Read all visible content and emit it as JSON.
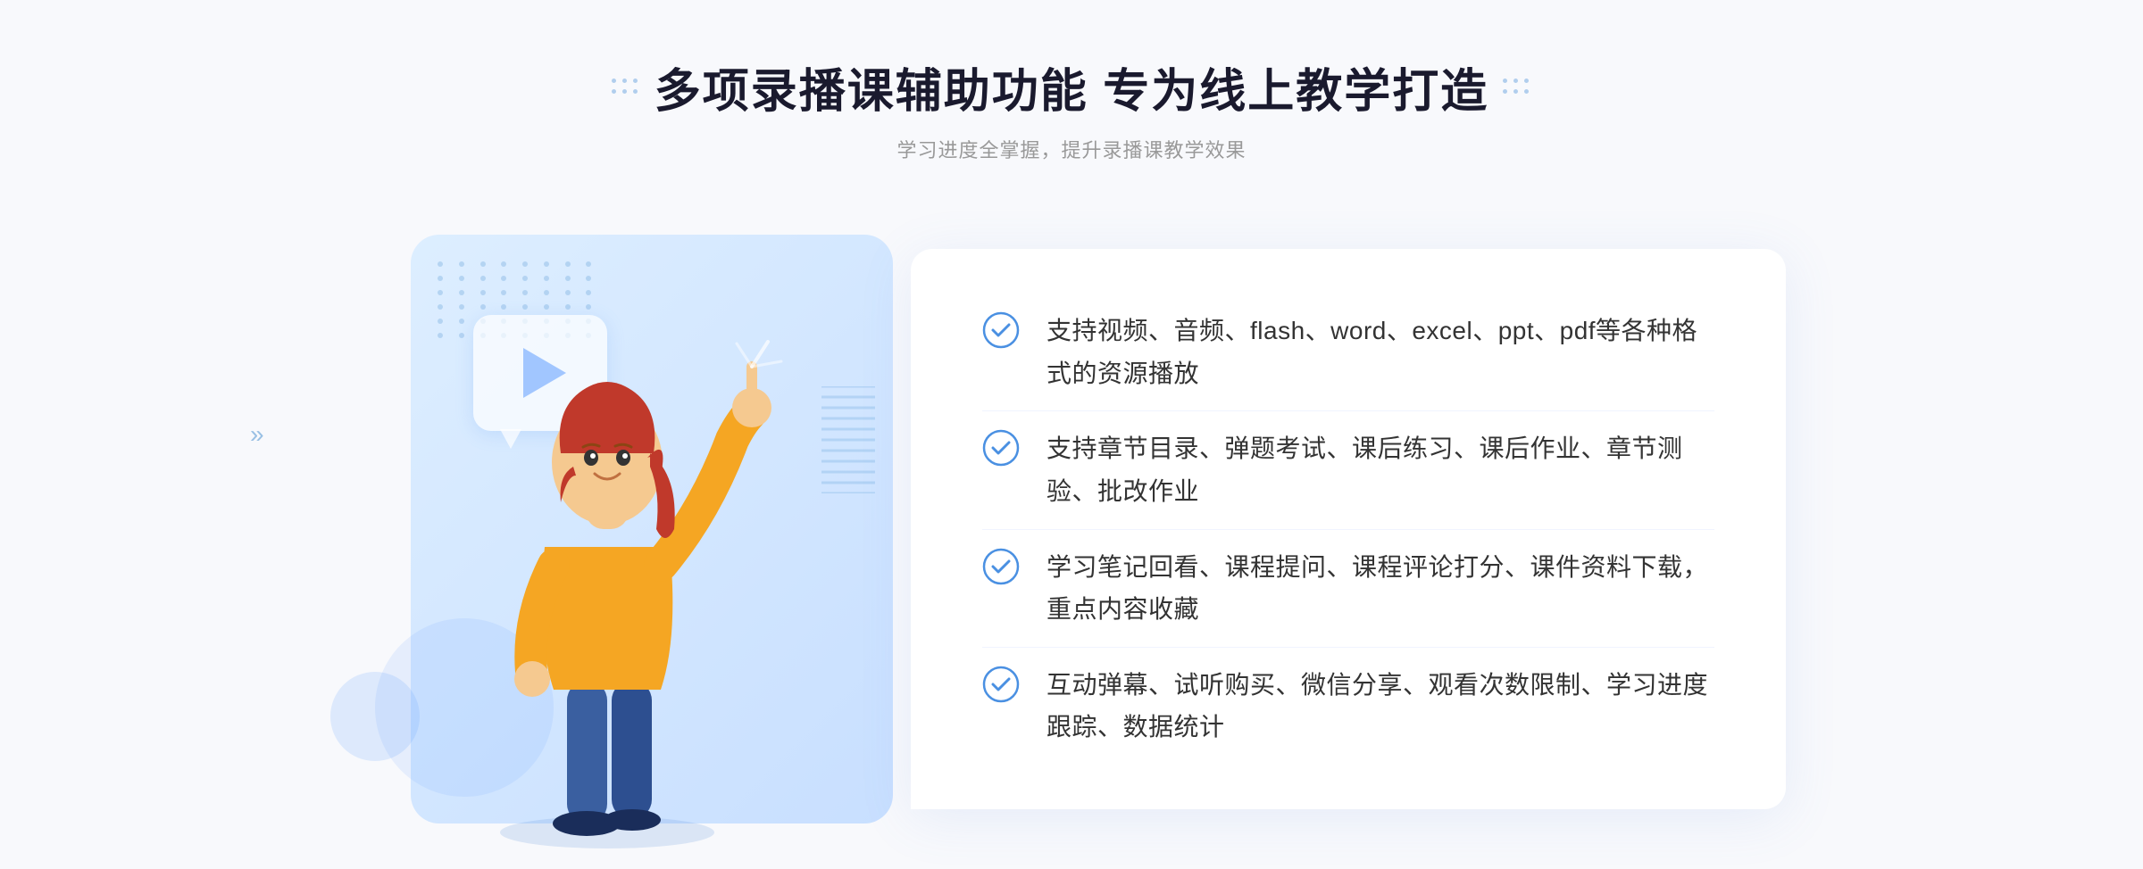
{
  "header": {
    "title": "多项录播课辅助功能 专为线上教学打造",
    "subtitle": "学习进度全掌握，提升录播课教学效果"
  },
  "features": [
    {
      "id": "feature-1",
      "text": "支持视频、音频、flash、word、excel、ppt、pdf等各种格式的资源播放"
    },
    {
      "id": "feature-2",
      "text": "支持章节目录、弹题考试、课后练习、课后作业、章节测验、批改作业"
    },
    {
      "id": "feature-3",
      "text": "学习笔记回看、课程提问、课程评论打分、课件资料下载，重点内容收藏"
    },
    {
      "id": "feature-4",
      "text": "互动弹幕、试听购买、微信分享、观看次数限制、学习进度跟踪、数据统计"
    }
  ],
  "colors": {
    "accent_blue": "#3b82f6",
    "light_blue": "#ddeeff",
    "text_dark": "#1a1a2e",
    "text_gray": "#999999",
    "text_body": "#333333",
    "check_color": "#4a90e2"
  },
  "icons": {
    "check_circle": "check-circle-icon",
    "play": "play-icon",
    "arrows_left": "left-arrows-icon"
  }
}
